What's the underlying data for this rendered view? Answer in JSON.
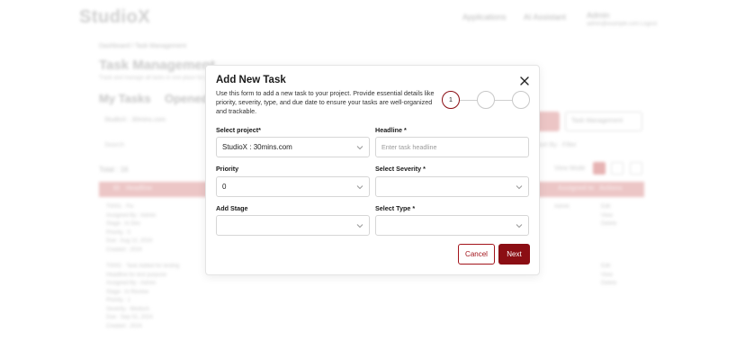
{
  "background": {
    "logo": "StudioX",
    "nav": [
      "Applications",
      "AI Assistant",
      "Admin"
    ],
    "user_line": "admin@example.com Logout",
    "breadcrumb": "Dashboard  /  Task Management",
    "page_title": "Task Management",
    "page_subtitle": "Track and manage all tasks in one place for your project team.",
    "tabs": [
      "My Tasks",
      "Opened"
    ],
    "project_select": "StudioX : 30mins.com",
    "manage_button": "Task Management",
    "search_placeholder": "Search",
    "filter_text": "Sort By  ·  Filter",
    "total": "Total : 16",
    "view_label": "View Mode",
    "table_headers": [
      "ID",
      "Headline",
      "Assigned to",
      "Actions"
    ],
    "rows": [
      {
        "lines": [
          "T0001 · Fix",
          "Assigned By : Admin",
          "Stage : In Dev",
          "Priority : 0",
          "Due : Aug 12, 2024",
          "Created : 2024"
        ],
        "assignee": "Admin",
        "actions": [
          "Edit",
          "View",
          "Delete"
        ]
      },
      {
        "lines": [
          "T0002 · Task Added for testing",
          "Headline for test purpose",
          "Assigned By : Admin",
          "Stage : In Review",
          "Priority : 1",
          "Severity : Medium",
          "Due : Sep 02, 2024",
          "Created : 2024"
        ],
        "assignee": "Admin",
        "actions": [
          "Edit",
          "View",
          "Delete"
        ]
      }
    ]
  },
  "modal": {
    "title": "Add New Task",
    "description": "Use this form to add a new task to your project. Provide essential details like priority, severity, type, and due date to ensure your tasks are well-organized and trackable.",
    "steps": [
      "1",
      "",
      ""
    ],
    "fields": {
      "project": {
        "label": "Select project*",
        "value": "StudioX : 30mins.com"
      },
      "headline": {
        "label": "Headline *",
        "placeholder": "Enter task headline"
      },
      "priority": {
        "label": "Priority",
        "value": "0"
      },
      "severity": {
        "label": "Select Severity *",
        "value": ""
      },
      "stage": {
        "label": "Add Stage",
        "value": ""
      },
      "type": {
        "label": "Select Type *",
        "value": ""
      }
    },
    "buttons": {
      "cancel": "Cancel",
      "next": "Next"
    }
  },
  "colors": {
    "accent": "#8b0e14",
    "accent_light": "#ecc6c6"
  }
}
